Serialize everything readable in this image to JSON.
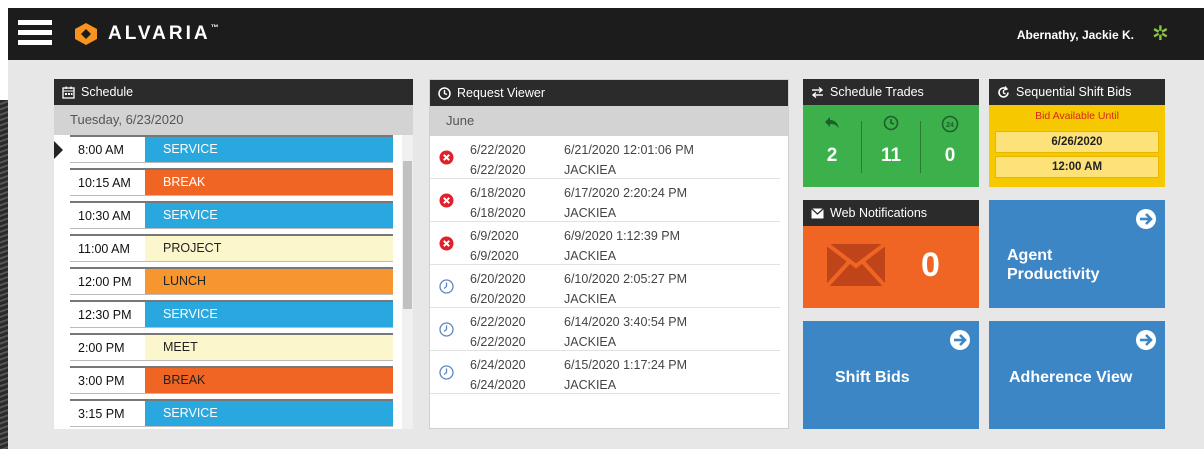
{
  "header": {
    "brand": "ALVARIA",
    "trademark": "™",
    "user_name": "Abernathy, Jackie K.",
    "icons": {
      "menu": "hamburger-menu-icon",
      "settings": "settings-gear-icon",
      "logo": "alvaria-logo-icon"
    },
    "colors": {
      "logo_orange": "#f7931e",
      "settings_green": "#8cc63f"
    }
  },
  "schedule": {
    "title": "Schedule",
    "date": "Tuesday, 6/23/2020",
    "items": [
      {
        "time": "8:00 AM",
        "activity": "SERVICE",
        "color": "#29a8e0",
        "text_color": "#ffffff",
        "current": true
      },
      {
        "time": "10:15 AM",
        "activity": "BREAK",
        "color": "#f06524",
        "text_color": "#ffffff"
      },
      {
        "time": "10:30 AM",
        "activity": "SERVICE",
        "color": "#29a8e0",
        "text_color": "#ffffff"
      },
      {
        "time": "11:00 AM",
        "activity": "PROJECT",
        "color": "#fcf6cc",
        "text_color": "#222222"
      },
      {
        "time": "12:00 PM",
        "activity": "LUNCH",
        "color": "#f7952f",
        "text_color": "#222222"
      },
      {
        "time": "12:30 PM",
        "activity": "SERVICE",
        "color": "#29a8e0",
        "text_color": "#ffffff"
      },
      {
        "time": "2:00 PM",
        "activity": "MEET",
        "color": "#fcf6cc",
        "text_color": "#222222"
      },
      {
        "time": "3:00 PM",
        "activity": "BREAK",
        "color": "#f06524",
        "text_color": "#222222"
      },
      {
        "time": "3:15 PM",
        "activity": "SERVICE",
        "color": "#29a8e0",
        "text_color": "#ffffff"
      }
    ]
  },
  "request_viewer": {
    "title": "Request Viewer",
    "month": "June",
    "rows": [
      {
        "status": "denied",
        "start": "6/22/2020",
        "end": "6/22/2020",
        "submitted": "6/21/2020 12:01:06 PM",
        "user": "JACKIEA"
      },
      {
        "status": "denied",
        "start": "6/18/2020",
        "end": "6/18/2020",
        "submitted": "6/17/2020 2:20:24 PM",
        "user": "JACKIEA"
      },
      {
        "status": "denied",
        "start": "6/9/2020",
        "end": "6/9/2020",
        "submitted": "6/9/2020 1:12:39 PM",
        "user": "JACKIEA"
      },
      {
        "status": "pending",
        "start": "6/20/2020",
        "end": "6/20/2020",
        "submitted": "6/10/2020 2:05:27 PM",
        "user": "JACKIEA"
      },
      {
        "status": "pending",
        "start": "6/22/2020",
        "end": "6/22/2020",
        "submitted": "6/14/2020 3:40:54 PM",
        "user": "JACKIEA"
      },
      {
        "status": "pending",
        "start": "6/24/2020",
        "end": "6/24/2020",
        "submitted": "6/15/2020 1:17:24 PM",
        "user": "JACKIEA"
      }
    ]
  },
  "schedule_trades": {
    "title": "Schedule Trades",
    "counts": [
      {
        "icon": "reply-arrow-icon",
        "value": "2"
      },
      {
        "icon": "clock-icon",
        "value": "11"
      },
      {
        "icon": "24-hour-icon",
        "value": "0"
      }
    ]
  },
  "sequential_shift_bids": {
    "title": "Sequential Shift Bids",
    "available_label": "Bid Available Until",
    "date": "6/26/2020",
    "time": "12:00 AM"
  },
  "web_notifications": {
    "title": "Web Notifications",
    "count": "0"
  },
  "tiles": {
    "agent_productivity": {
      "line1": "Agent",
      "line2": "Productivity"
    },
    "shift_bids": {
      "label": "Shift Bids"
    },
    "adherence_view": {
      "label": "Adherence View"
    }
  }
}
